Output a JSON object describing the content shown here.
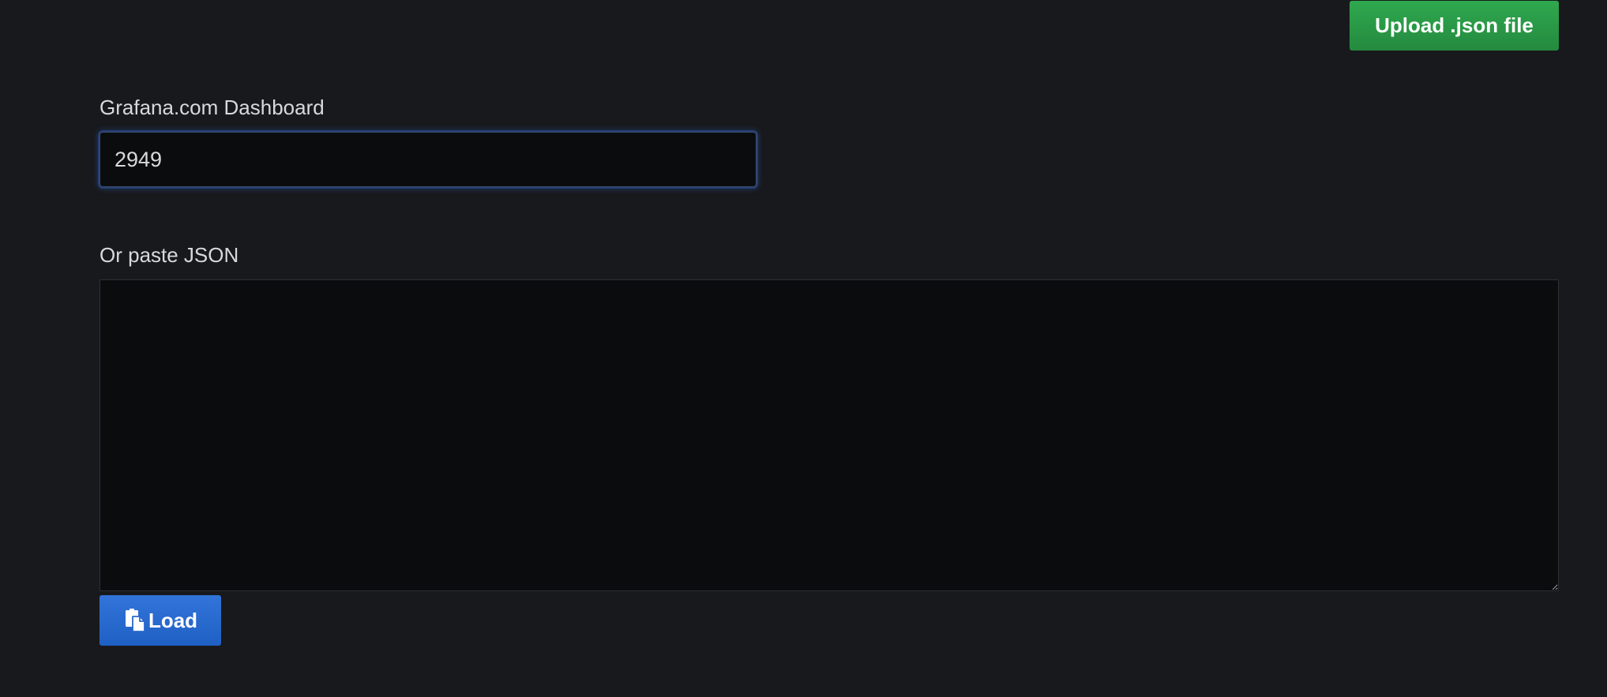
{
  "actions": {
    "upload_label": "Upload .json file"
  },
  "grafana_dashboard": {
    "label": "Grafana.com Dashboard",
    "value": "2949"
  },
  "json_paste": {
    "label": "Or paste JSON",
    "value": ""
  },
  "load_button": {
    "label": "Load",
    "icon": "paste-icon"
  },
  "colors": {
    "background": "#18191c",
    "upload_button": "#299c46",
    "load_button": "#3274d9",
    "input_background": "#0b0c0e",
    "focus_glow": "#3366cc"
  }
}
